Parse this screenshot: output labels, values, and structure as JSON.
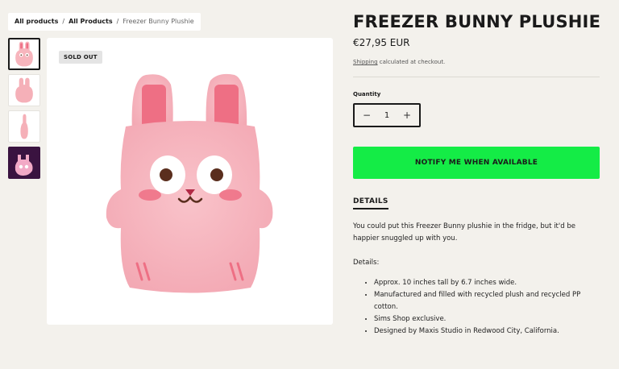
{
  "breadcrumb": {
    "items": [
      "All products",
      "All Products",
      "Freezer Bunny Plushie"
    ],
    "separator": "/"
  },
  "gallery": {
    "thumbnails": [
      "bunny-front",
      "bunny-back",
      "bunny-side",
      "bunny-in-game"
    ],
    "badge": "SOLD OUT"
  },
  "product": {
    "title": "FREEZER BUNNY PLUSHIE",
    "price": "€27,95 EUR",
    "shipping_link": "Shipping",
    "shipping_note": " calculated at checkout.",
    "quantity_label": "Quantity",
    "quantity_value": "1",
    "minus": "−",
    "plus": "+",
    "notify_label": "NOTIFY ME WHEN AVAILABLE"
  },
  "details": {
    "heading": "DETAILS",
    "description": "You could put this Freezer Bunny plushie in the fridge, but it'd be happier snuggled up with you.",
    "subheading": "Details:",
    "bullets": [
      "Approx. 10 inches tall by 6.7 inches wide.",
      "Manufactured and filled with recycled plush and recycled PP cotton.",
      "Sims Shop exclusive.",
      "Designed by Maxis Studio in Redwood City, California."
    ]
  },
  "colors": {
    "background": "#f3f1ec",
    "notify_button": "#14ec46",
    "plush_pink": "#f7b5bd"
  }
}
